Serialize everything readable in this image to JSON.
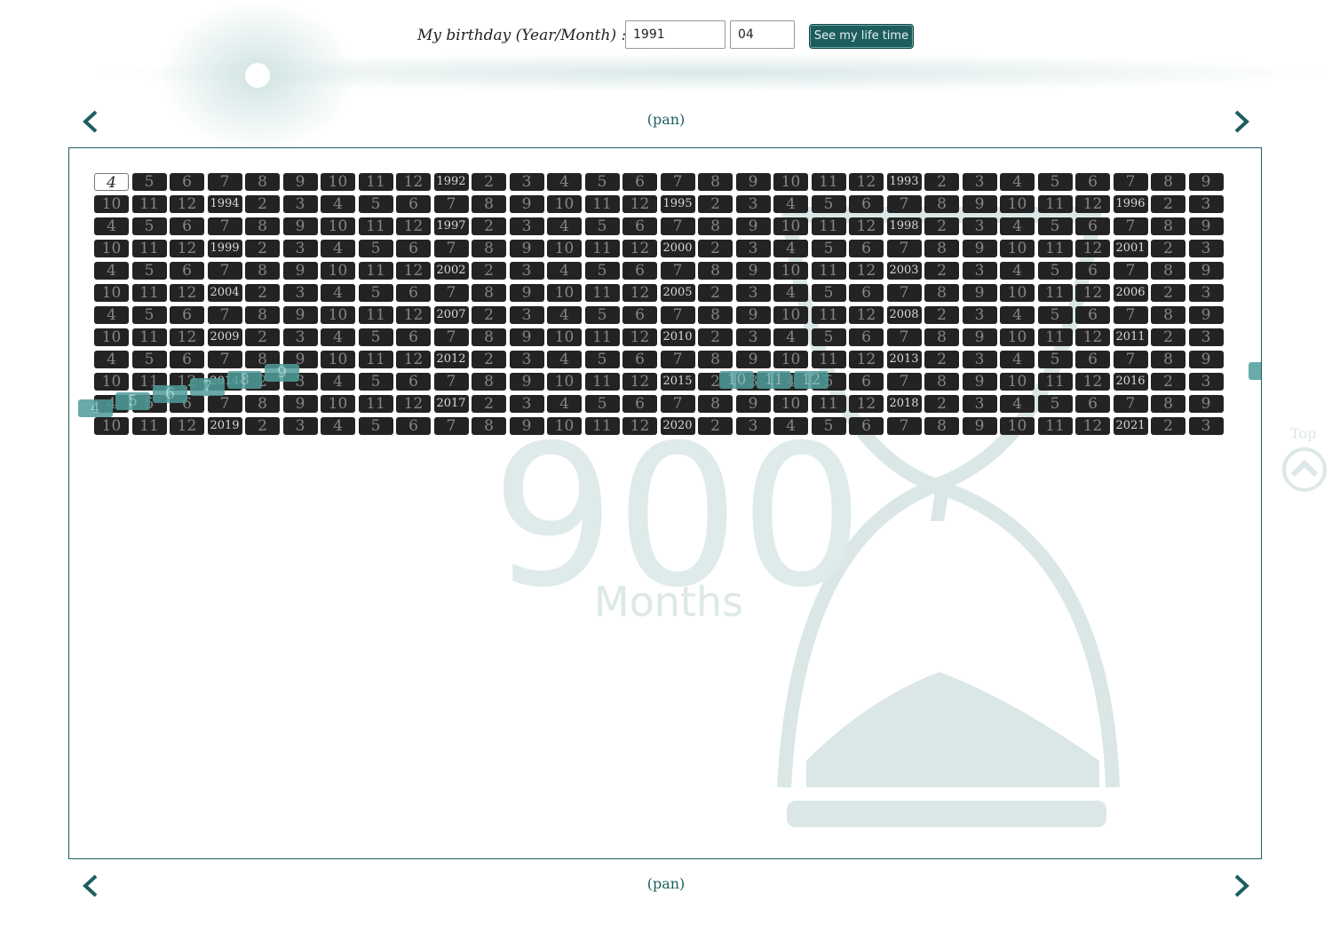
{
  "header": {
    "birthday_label": "My birthday (Year/Month) :",
    "year_value": "1991",
    "month_value": "04",
    "submit_label": "See my life time"
  },
  "nav": {
    "pan_top": "(pan)",
    "pan_bottom": "(pan)",
    "prev_icon": "chevron-left-icon",
    "next_icon": "chevron-right-icon"
  },
  "watermark": {
    "big_number": "900",
    "unit": "Months"
  },
  "top_button": {
    "label": "Top",
    "icon": "circle-chevron-up-icon"
  },
  "timeline": {
    "columns": 30,
    "birth_year": 1991,
    "birth_month": 4,
    "current_index": 363,
    "lived_until_index": 362,
    "cells": [
      "4",
      "5",
      "6",
      "7",
      "8",
      "9",
      "10",
      "11",
      "12",
      "1992",
      "2",
      "3",
      "4",
      "5",
      "6",
      "7",
      "8",
      "9",
      "10",
      "11",
      "12",
      "1993",
      "2",
      "3",
      "4",
      "5",
      "6",
      "7",
      "8",
      "9",
      "10",
      "11",
      "12",
      "1994",
      "2",
      "3",
      "4",
      "5",
      "6",
      "7",
      "8",
      "9",
      "10",
      "11",
      "12",
      "1995",
      "2",
      "3",
      "4",
      "5",
      "6",
      "7",
      "8",
      "9",
      "10",
      "11",
      "12",
      "1996",
      "2",
      "3",
      "4",
      "5",
      "6",
      "7",
      "8",
      "9",
      "10",
      "11",
      "12",
      "1997",
      "2",
      "3",
      "4",
      "5",
      "6",
      "7",
      "8",
      "9",
      "10",
      "11",
      "12",
      "1998",
      "2",
      "3",
      "4",
      "5",
      "6",
      "7",
      "8",
      "9",
      "10",
      "11",
      "12",
      "1999",
      "2",
      "3",
      "4",
      "5",
      "6",
      "7",
      "8",
      "9",
      "10",
      "11",
      "12",
      "2000",
      "2",
      "3",
      "4",
      "5",
      "6",
      "7",
      "8",
      "9",
      "10",
      "11",
      "12",
      "2001",
      "2",
      "3",
      "4",
      "5",
      "6",
      "7",
      "8",
      "9",
      "10",
      "11",
      "12",
      "2002",
      "2",
      "3",
      "4",
      "5",
      "6",
      "7",
      "8",
      "9",
      "10",
      "11",
      "12",
      "2003",
      "2",
      "3",
      "4",
      "5",
      "6",
      "7",
      "8",
      "9",
      "10",
      "11",
      "12",
      "2004",
      "2",
      "3",
      "4",
      "5",
      "6",
      "7",
      "8",
      "9",
      "10",
      "11",
      "12",
      "2005",
      "2",
      "3",
      "4",
      "5",
      "6",
      "7",
      "8",
      "9",
      "10",
      "11",
      "12",
      "2006",
      "2",
      "3",
      "4",
      "5",
      "6",
      "7",
      "8",
      "9",
      "10",
      "11",
      "12",
      "2007",
      "2",
      "3",
      "4",
      "5",
      "6",
      "7",
      "8",
      "9",
      "10",
      "11",
      "12",
      "2008",
      "2",
      "3",
      "4",
      "5",
      "6",
      "7",
      "8",
      "9",
      "10",
      "11",
      "12",
      "2009",
      "2",
      "3",
      "4",
      "5",
      "6",
      "7",
      "8",
      "9",
      "10",
      "11",
      "12",
      "2010",
      "2",
      "3",
      "4",
      "5",
      "6",
      "7",
      "8",
      "9",
      "10",
      "11",
      "12",
      "2011",
      "2",
      "3",
      "4",
      "5",
      "6",
      "7",
      "8",
      "9",
      "10",
      "11",
      "12",
      "2012",
      "2",
      "3",
      "4",
      "5",
      "6",
      "7",
      "8",
      "9",
      "10",
      "11",
      "12",
      "2013",
      "2",
      "3",
      "4",
      "5",
      "6",
      "7",
      "8",
      "9",
      "10",
      "11",
      "12",
      "2014",
      "2",
      "3",
      "4",
      "5",
      "6",
      "7",
      "8",
      "9",
      "10",
      "11",
      "12",
      "2015",
      "2",
      "3",
      "4",
      "5",
      "6",
      "7",
      "8",
      "9",
      "10",
      "11",
      "12",
      "2016",
      "2",
      "3",
      "4",
      "5",
      "6",
      "7",
      "8",
      "9",
      "10",
      "11",
      "12",
      "2017",
      "2",
      "3",
      "4",
      "5",
      "6",
      "7",
      "8",
      "9",
      "10",
      "11",
      "12",
      "2018",
      "2",
      "3",
      "4",
      "5",
      "6",
      "7",
      "8",
      "9",
      "10",
      "11",
      "12",
      "2019",
      "2",
      "3",
      "4",
      "5",
      "6",
      "7",
      "8",
      "9",
      "10",
      "11",
      "12",
      "2020",
      "2",
      "3",
      "4",
      "5",
      "6",
      "7",
      "8",
      "9",
      "10",
      "11",
      "12",
      "2021",
      "2",
      "3"
    ]
  },
  "animating": [
    "4",
    "5",
    "6",
    "7",
    "8",
    "9",
    "10",
    "11",
    "12",
    "2",
    "3"
  ],
  "colors": {
    "accent": "#1d5e5d",
    "cell_dark": "#232323",
    "cell_lived": "#1d6b6a",
    "cell_now": "#11bcbc"
  }
}
